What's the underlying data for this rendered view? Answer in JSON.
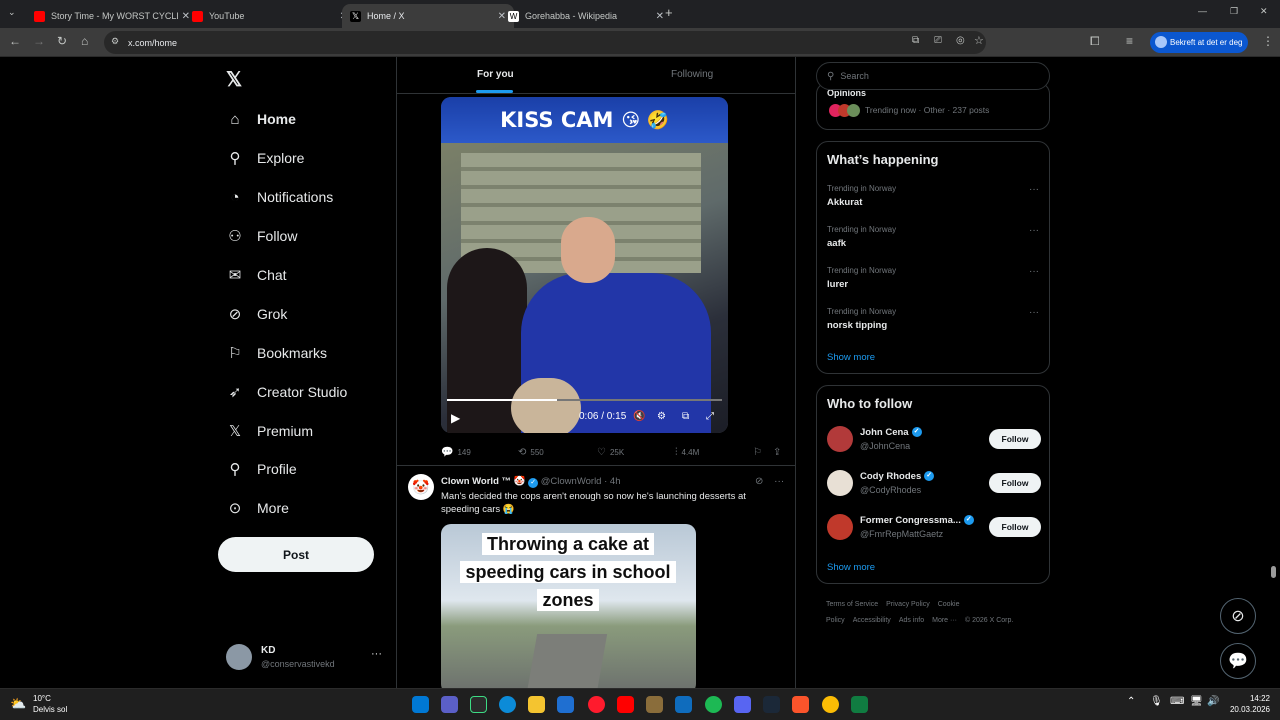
{
  "browser": {
    "tabs": [
      {
        "title": "Story Time - My WORST CYCLE",
        "color": "#ff0000"
      },
      {
        "title": "YouTube",
        "color": "#ff0000"
      },
      {
        "title": "Home / X",
        "color": "#000000"
      },
      {
        "title": "Gorehabba - Wikipedia",
        "color": "#ffffff"
      }
    ],
    "url": "x.com/home",
    "profile_button": "Bekreft at det er deg"
  },
  "nav": {
    "items": [
      {
        "label": "Home",
        "icon": "home-icon",
        "glyph": "⌂"
      },
      {
        "label": "Explore",
        "icon": "search-icon",
        "glyph": "⚲"
      },
      {
        "label": "Notifications",
        "icon": "bell-icon",
        "glyph": "◔"
      },
      {
        "label": "Follow",
        "icon": "person-add-icon",
        "glyph": "⚇"
      },
      {
        "label": "Chat",
        "icon": "envelope-icon",
        "glyph": "✉"
      },
      {
        "label": "Grok",
        "icon": "grok-icon",
        "glyph": "⊘"
      },
      {
        "label": "Bookmarks",
        "icon": "bookmark-icon",
        "glyph": "⚐"
      },
      {
        "label": "Creator Studio",
        "icon": "rocket-icon",
        "glyph": "➶"
      },
      {
        "label": "Premium",
        "icon": "x-icon",
        "glyph": "𝕏"
      },
      {
        "label": "Profile",
        "icon": "person-icon",
        "glyph": "⚲"
      },
      {
        "label": "More",
        "icon": "more-circle-icon",
        "glyph": "⊙"
      }
    ],
    "post_label": "Post",
    "account": {
      "name": "KD",
      "handle": "@conservastivekd"
    }
  },
  "feed": {
    "tabs": [
      "For you",
      "Following"
    ],
    "video": {
      "banner": "KISS CAM",
      "time": "0:06 / 0:15",
      "progress": 0.4
    },
    "actions": {
      "replies": "149",
      "reposts": "550",
      "likes": "25K",
      "views": "4.4M"
    },
    "tweet": {
      "name": "Clown World ™",
      "handle": "@ClownWorld",
      "time": "· 4h",
      "text": "Man's decided the cops aren't enough so now he's launching desserts at speeding cars 😭",
      "media_caption": "Throwing a cake at speeding cars in school zones"
    }
  },
  "sidebar": {
    "search_placeholder": "Search",
    "top_trend": {
      "title": "Opinions",
      "meta": "Trending now · Other · 237 posts"
    },
    "happening_title": "What’s happening",
    "trends": [
      {
        "category": "Trending in Norway",
        "name": "Akkurat"
      },
      {
        "category": "Trending in Norway",
        "name": "aafk"
      },
      {
        "category": "Trending in Norway",
        "name": "lurer"
      },
      {
        "category": "Trending in Norway",
        "name": "norsk tipping"
      }
    ],
    "show_more": "Show more",
    "follow_title": "Who to follow",
    "follow": [
      {
        "name": "John Cena",
        "handle": "@JohnCena",
        "button": "Follow"
      },
      {
        "name": "Cody Rhodes",
        "handle": "@CodyRhodes",
        "button": "Follow"
      },
      {
        "name": "Former Congressma...",
        "handle": "@FmrRepMattGaetz",
        "button": "Follow"
      }
    ],
    "footer": [
      "Terms of Service",
      "Privacy Policy",
      "Cookie Policy",
      "Accessibility",
      "Ads info",
      "More ···",
      "© 2026 X Corp."
    ]
  },
  "taskbar": {
    "temp": "10°C",
    "condition": "Delvis sol",
    "time": "14:22",
    "date": "20.03.2026"
  }
}
